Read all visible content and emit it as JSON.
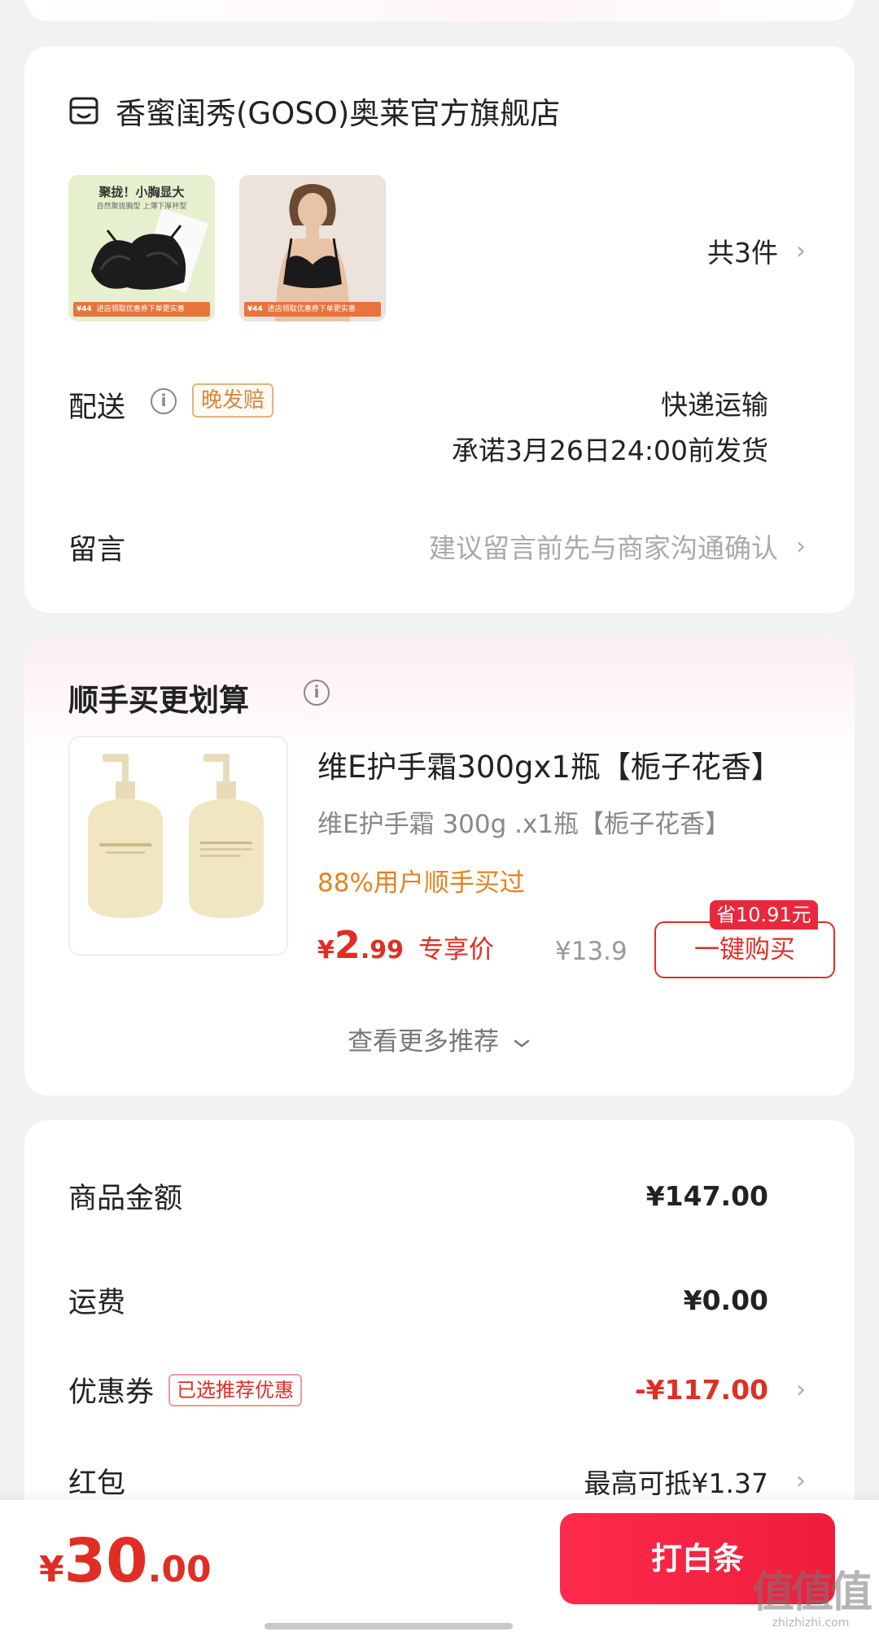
{
  "store": {
    "name": "香蜜闺秀(GOSO)奥莱官方旗舰店",
    "products": [
      {
        "headline": "聚拢！小胸显大",
        "subline": "自然聚拢胸型 上薄下厚杯型",
        "price_tag": "¥44",
        "tag_text": "进店领取优惠券下单更实惠"
      },
      {
        "price_tag": "¥44",
        "tag_text": "进店领取优惠券下单更实惠"
      }
    ],
    "item_count": "共3件",
    "shipping_label": "配送",
    "late_badge": "晚发赔",
    "shipping_method": "快递运输",
    "shipping_promise": "承诺3月26日24:00前发货",
    "message_label": "留言",
    "message_placeholder": "建议留言前先与商家沟通确认"
  },
  "recommend": {
    "title": "顺手买更划算",
    "product_name": "维E护手霜300gx1瓶【栀子花香】",
    "product_spec": "维E护手霜 300g .x1瓶【栀子花香】",
    "social_proof": "88%用户顺手买过",
    "price_currency": "¥",
    "price_int": "2",
    "price_dec": ".99",
    "price_tag": "专享价",
    "original_price": "¥13.9",
    "save_badge": "省10.91元",
    "buy_button": "一键购买",
    "see_more": "查看更多推荐"
  },
  "fees": {
    "goods_label": "商品金额",
    "goods_value": "¥147.00",
    "freight_label": "运费",
    "freight_value": "¥0.00",
    "coupon_label": "优惠券",
    "coupon_badge": "已选推荐优惠",
    "coupon_value": "-¥117.00",
    "redpacket_label": "红包",
    "redpacket_value": "最高可抵¥1.37"
  },
  "bottom": {
    "total_currency": "¥",
    "total_int": "30",
    "total_dec": ".00",
    "pay_button": "打白条"
  },
  "watermark": {
    "main": "值值值",
    "site": "zhizhizhi.com"
  },
  "colors": {
    "accent_red": "#e02e24",
    "pay_button": "#ef1d3b",
    "orange": "#e38320"
  }
}
